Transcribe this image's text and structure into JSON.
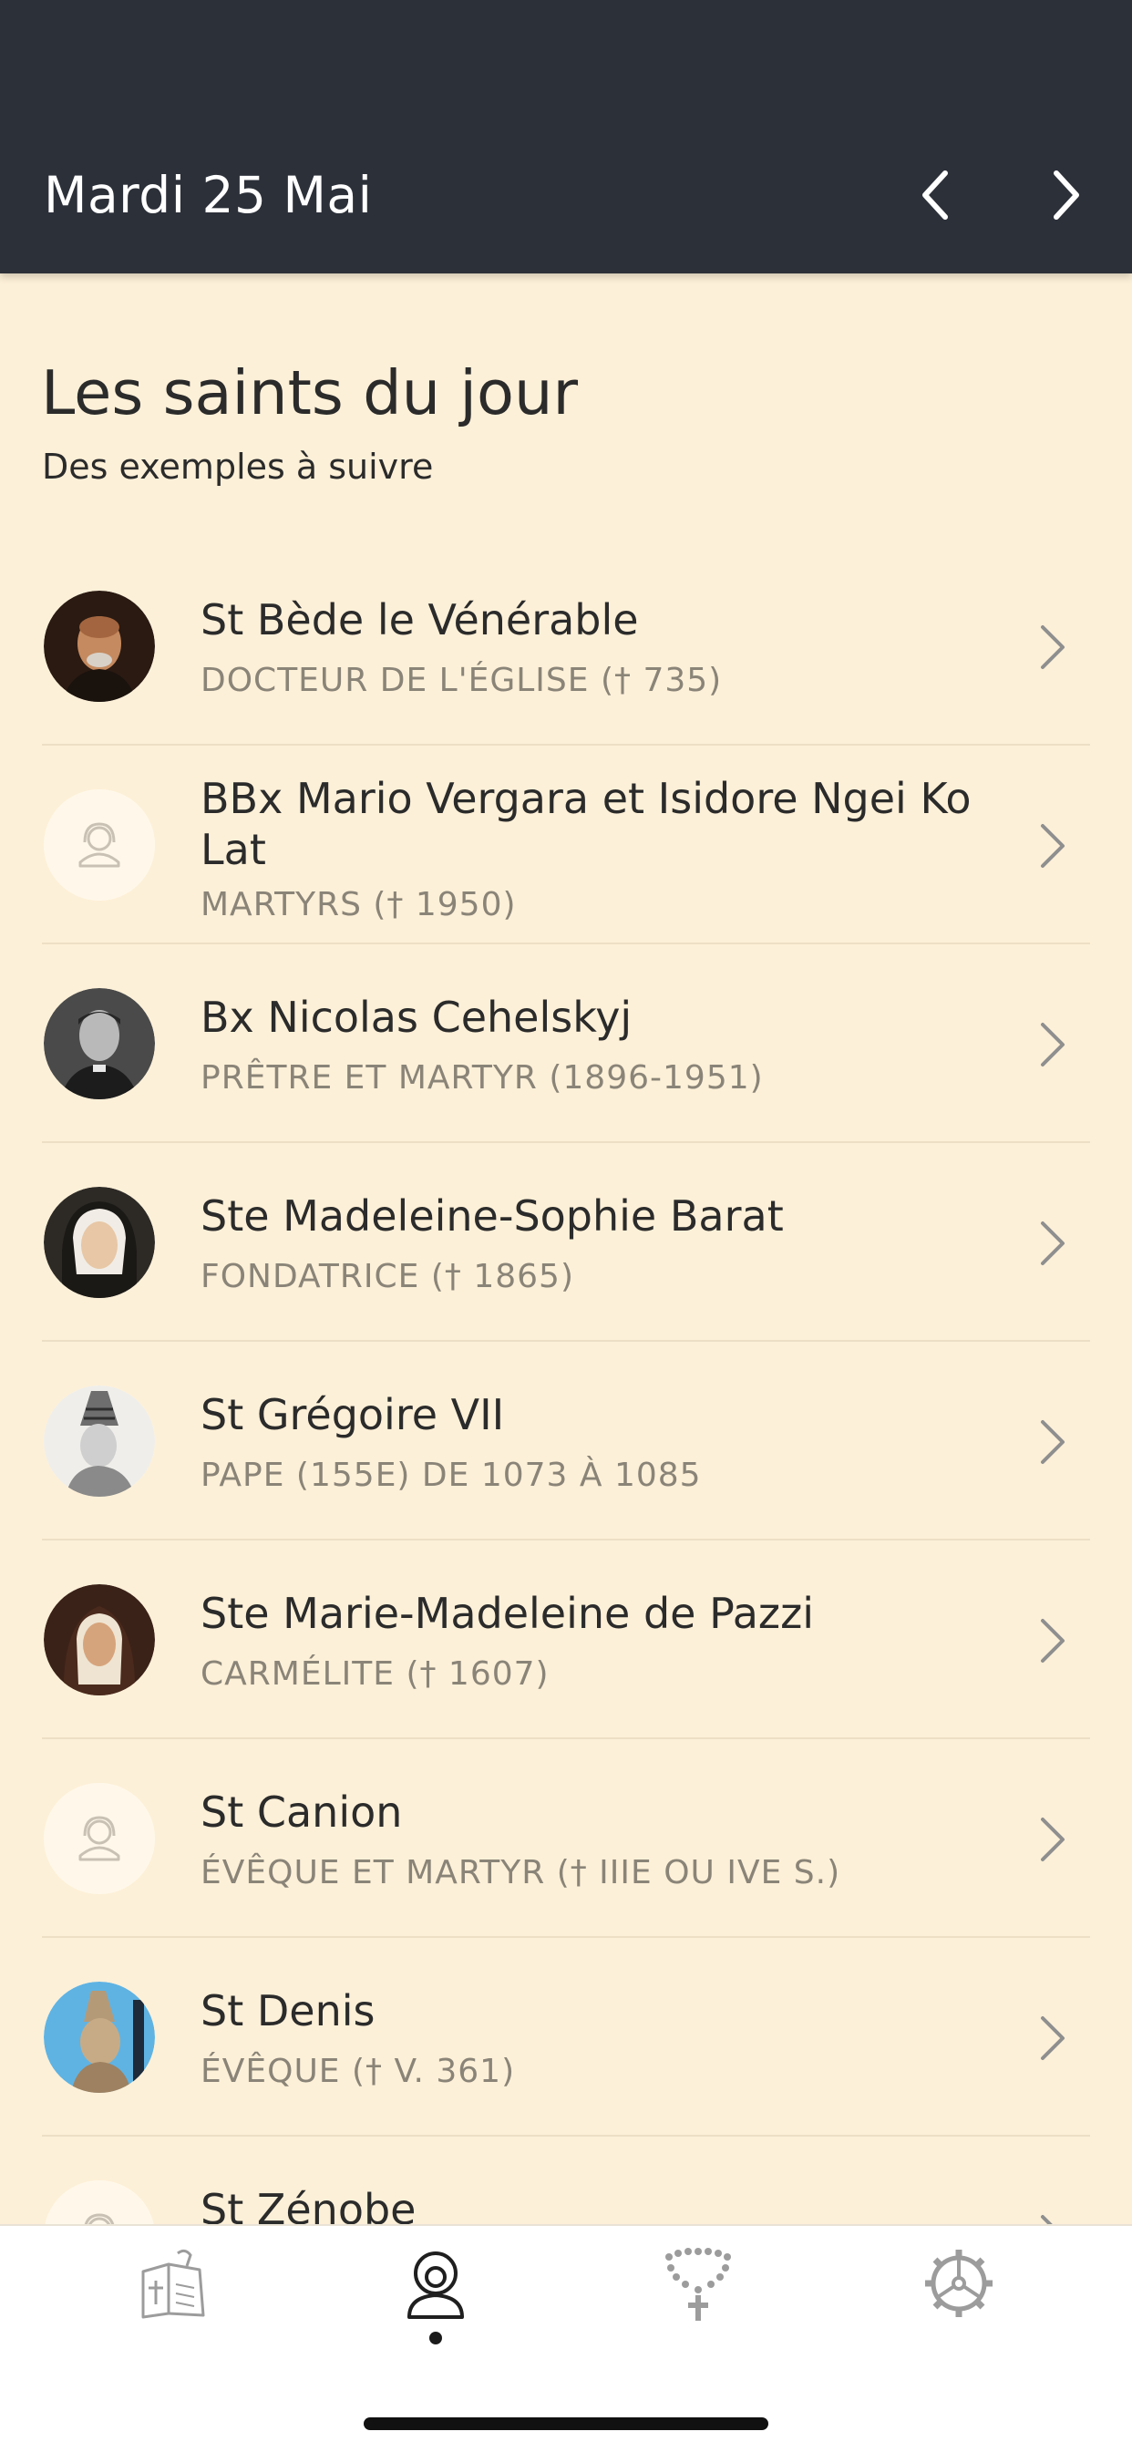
{
  "header": {
    "title": "Mardi 25 Mai"
  },
  "section": {
    "title": "Les saints du jour",
    "subtitle": "Des exemples à suivre"
  },
  "saints": [
    {
      "name": "St Bède le Vénérable",
      "description": "DOCTEUR DE L'ÉGLISE († 735)",
      "avatar": "portrait-photo"
    },
    {
      "name": "BBx Mario Vergara et Isidore Ngei Ko Lat",
      "description": "MARTYRS († 1950)",
      "avatar": "placeholder-person-icon"
    },
    {
      "name": "Bx Nicolas Cehelskyj",
      "description": "PRÊTRE ET MARTYR (1896-1951)",
      "avatar": "portrait-photo"
    },
    {
      "name": "Ste Madeleine-Sophie Barat",
      "description": "FONDATRICE († 1865)",
      "avatar": "portrait-photo"
    },
    {
      "name": "St Grégoire VII",
      "description": "PAPE  (155E) DE 1073 À 1085",
      "avatar": "portrait-photo"
    },
    {
      "name": "Ste Marie-Madeleine de Pazzi",
      "description": "CARMÉLITE († 1607)",
      "avatar": "portrait-photo"
    },
    {
      "name": "St Canion",
      "description": "ÉVÊQUE ET MARTYR († IIIE OU IVE S.)",
      "avatar": "placeholder-person-icon"
    },
    {
      "name": "St Denis",
      "description": "ÉVÊQUE († V. 361)",
      "avatar": "portrait-photo"
    },
    {
      "name": "St Zénobe",
      "description": "",
      "avatar": "placeholder-person-icon"
    }
  ],
  "tabs": [
    {
      "id": "readings",
      "icon": "book-cross-icon"
    },
    {
      "id": "saints",
      "icon": "person-icon",
      "active": true
    },
    {
      "id": "rosary",
      "icon": "rosary-icon"
    },
    {
      "id": "settings",
      "icon": "gear-icon"
    }
  ],
  "colors": {
    "header_bg": "#2c3039",
    "page_bg": "#fdf0d8",
    "secondary_text": "#8a8478",
    "separator": "#ecdfc6"
  }
}
